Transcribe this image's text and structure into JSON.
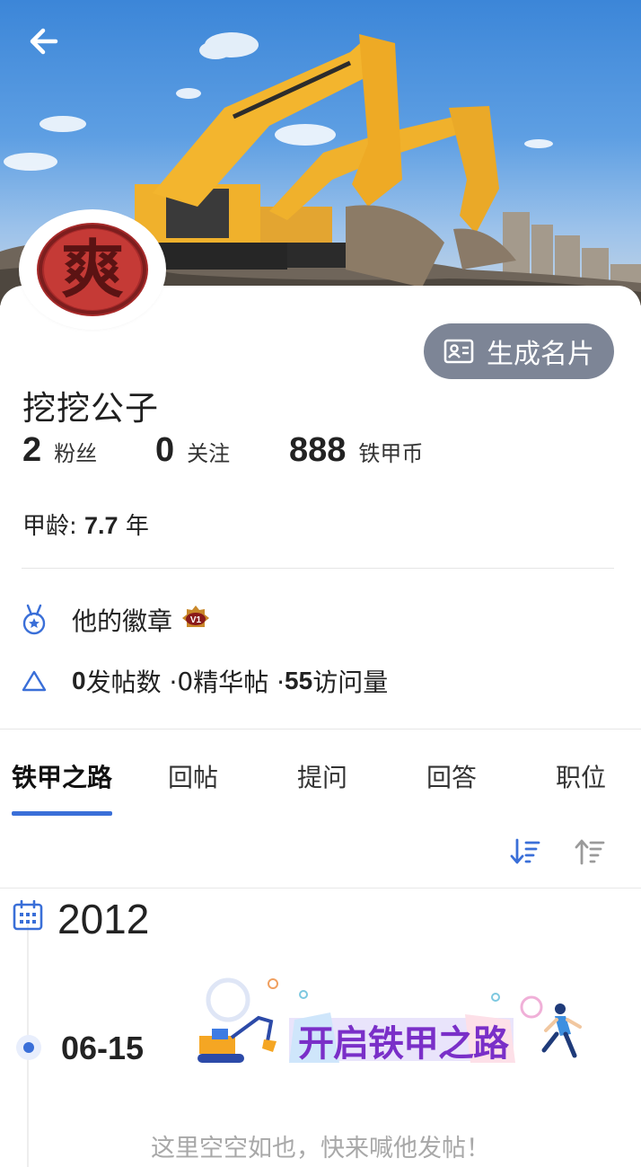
{
  "header": {
    "back_icon": "arrow-left-icon"
  },
  "profile": {
    "username": "挖挖公子",
    "card_button_label": "生成名片",
    "avatar_char": "爽"
  },
  "stats": [
    {
      "value": "2",
      "label": "粉丝"
    },
    {
      "value": "0",
      "label": "关注"
    },
    {
      "value": "888",
      "label": "铁甲币"
    }
  ],
  "age": {
    "label": "甲龄: ",
    "value": "7.7",
    "unit": " 年"
  },
  "badges": {
    "label": "他的徽章",
    "badge_text": "V1"
  },
  "activity": {
    "posts_value": "0",
    "posts_label": " 发帖数 · ",
    "essence_value": "0",
    "essence_label": " 精华帖 · ",
    "visits_value": "55",
    "visits_label": " 访问量"
  },
  "tabs": [
    {
      "label": "铁甲之路",
      "active": true
    },
    {
      "label": "回帖",
      "active": false
    },
    {
      "label": "提问",
      "active": false
    },
    {
      "label": "回答",
      "active": false
    },
    {
      "label": "职位",
      "active": false
    }
  ],
  "timeline": {
    "year": "2012",
    "date": "06-15",
    "banner_text": "开启铁甲之路",
    "empty_text": "这里空空如也，快来喊他发帖！"
  },
  "colors": {
    "accent": "#3a6fd8",
    "button_bg": "#7d8596",
    "banner_text": "#7a2fc8"
  }
}
